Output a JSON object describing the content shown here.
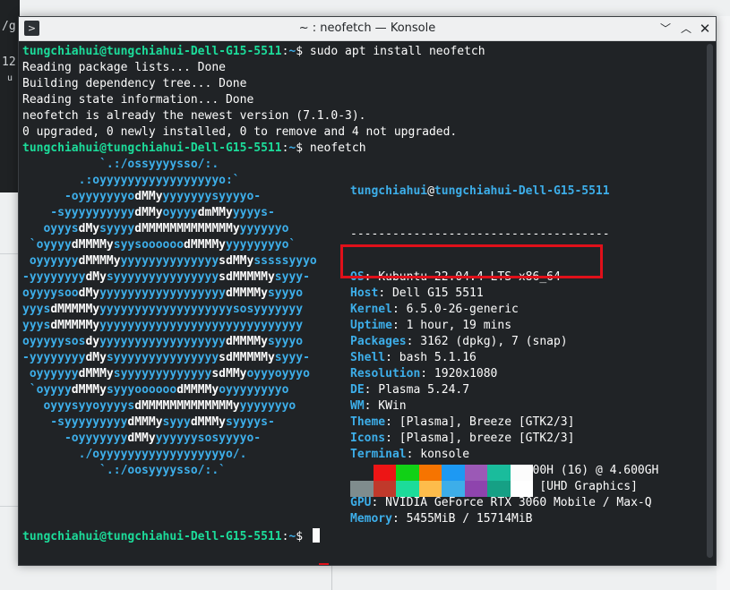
{
  "background": {
    "snippets": [
      "/g",
      "12",
      "u"
    ]
  },
  "window": {
    "title": "~ : neofetch — Konsole",
    "buttons": {
      "minimize": "﹀",
      "maximize": "︿",
      "close": "✕"
    }
  },
  "terminal": {
    "prompt_user": "tungchiahui@tungchiahui-Dell-G15-5511",
    "prompt_sep": ":",
    "prompt_path": "~",
    "prompt_dollar": "$ ",
    "command1": "sudo apt install neofetch",
    "output": [
      "Reading package lists... Done",
      "Building dependency tree... Done",
      "Reading state information... Done",
      "neofetch is already the newest version (7.1.0-3).",
      "0 upgraded, 0 newly installed, 0 to remove and 4 not upgraded."
    ],
    "command2": "neofetch",
    "ascii": [
      [
        "           `.:/ossyyyysso/:.",
        ""
      ],
      [
        "        .:oyyyyyyyyyyyyyyyyyo:`",
        ""
      ],
      [
        "      -oyyyyyyyo",
        "dMMy",
        "yyyyyyysyyyyo-"
      ],
      [
        "    -syyyyyyyyyy",
        "dMMy",
        "oyyyy",
        "dmMMy",
        "yyyys-"
      ],
      [
        "   oyyys",
        "dMy",
        "syyyy",
        "dMMMMMMMMMMMMMy",
        "yyyyyyo"
      ],
      [
        " `oyyyy",
        "dMMMMy",
        "syysoooooo",
        "dMMMMy",
        "yyyyyyyyo`"
      ],
      [
        " oyyyyyy",
        "dMMMMy",
        "yyyyyyyyyyyyyy",
        "sdMMy",
        "sssssyyyo"
      ],
      [
        "-yyyyyyyy",
        "dMy",
        "syyyyyyyyyyyyyyy",
        "sdMMMMMy",
        "syyy-"
      ],
      [
        "oyyyysoo",
        "dMy",
        "yyyyyyyyyyyyyyyyyy",
        "dMMMMy",
        "syyyo"
      ],
      [
        "yyys",
        "dMMMMMy",
        "yyyyyyyyyyyyyyyyyyysosyyyyyyy"
      ],
      [
        "yyys",
        "dMMMMMy",
        "yyyyyyyyyyyyyyyyyyyyyyyyyyyyy"
      ],
      [
        "oyyyyysos",
        "dy",
        "yyyyyyyyyyyyyyyyyy",
        "dMMMMy",
        "syyyo"
      ],
      [
        "-yyyyyyyy",
        "dMy",
        "syyyyyyyyyyyyyyy",
        "sdMMMMMy",
        "syyy-"
      ],
      [
        " oyyyyyy",
        "dMMMy",
        "syyyyyyyyyyyyy",
        "sdMMy",
        "oyyyoyyyo"
      ],
      [
        " `oyyyy",
        "dMMMy",
        "syyyoooooo",
        "dMMMMy",
        "oyyyyyyyyo"
      ],
      [
        "   oyyysyyoyyyys",
        "dMMMMMMMMMMMMMy",
        "yyyyyyyo"
      ],
      [
        "    -syyyyyyyyy",
        "dMMMy",
        "syyy",
        "dMMMy",
        "syyyys-"
      ],
      [
        "      -oyyyyyyy",
        "dMMy",
        "yyyyyysosyyyyo-"
      ],
      [
        "        ./oyyyyyyyyyyyyyyyyyyo/.",
        ""
      ],
      [
        "           `.:/oosyyyysso/:.`",
        ""
      ]
    ],
    "info_header_user": "tungchiahui",
    "info_header_at": "@",
    "info_header_host": "tungchiahui-Dell-G15-5511",
    "info_separator": "-------------------------------------",
    "info": [
      {
        "key": "OS",
        "value": ": Kubuntu 22.04.4 LTS x86_64"
      },
      {
        "key": "Host",
        "value": ": Dell G15 5511"
      },
      {
        "key": "Kernel",
        "value": ": 6.5.0-26-generic"
      },
      {
        "key": "Uptime",
        "value": ": 1 hour, 19 mins"
      },
      {
        "key": "Packages",
        "value": ": 3162 (dpkg), 7 (snap)"
      },
      {
        "key": "Shell",
        "value": ": bash 5.1.16"
      },
      {
        "key": "Resolution",
        "value": ": 1920x1080"
      },
      {
        "key": "DE",
        "value": ": Plasma 5.24.7"
      },
      {
        "key": "WM",
        "value": ": KWin"
      },
      {
        "key": "Theme",
        "value": ": [Plasma], Breeze [GTK2/3]"
      },
      {
        "key": "Icons",
        "value": ": [Plasma], breeze [GTK2/3]"
      },
      {
        "key": "Terminal",
        "value": ": konsole"
      },
      {
        "key": "CPU",
        "value": ": 11th Gen Intel i7-11800H (16) @ 4.600GH"
      },
      {
        "key": "GPU",
        "value": ": Intel TigerLake-H GT1 [UHD Graphics]"
      },
      {
        "key": "GPU",
        "value": ": NVIDIA GeForce RTX 3060 Mobile / Max-Q"
      },
      {
        "key": "Memory",
        "value": ": 5455MiB / 15714MiB"
      }
    ],
    "palette_top": [
      "#202326",
      "#ed1515",
      "#11d116",
      "#f67400",
      "#1d99f3",
      "#9b59b6",
      "#1abc9c",
      "#fcfcfc"
    ],
    "palette_bottom": [
      "#7f8c8d",
      "#c0392b",
      "#1cdc9a",
      "#fdbc4b",
      "#3daee9",
      "#8e44ad",
      "#16a085",
      "#ffffff"
    ]
  }
}
